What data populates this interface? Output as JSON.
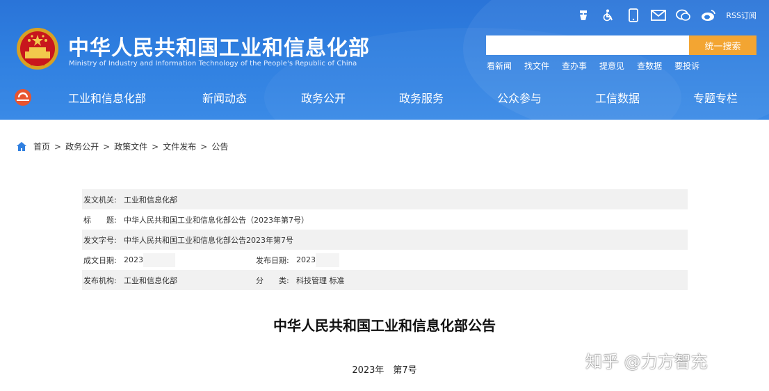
{
  "site": {
    "title_cn": "中华人民共和国工业和信息化部",
    "title_en": "Ministry of Industry and Information Technology of the People's Republic of China"
  },
  "top_icons": [
    "accessibility-tool-icon",
    "wheelchair-icon",
    "mobile-icon",
    "mail-icon",
    "weibo-icon",
    "wechat-icon"
  ],
  "rss_label": "RSS订阅",
  "search": {
    "placeholder": "",
    "button_label": "统一搜索"
  },
  "quick_links": [
    "看新闻",
    "找文件",
    "查办事",
    "提意见",
    "查数据",
    "要投诉"
  ],
  "nav": [
    "工业和信息化部",
    "新闻动态",
    "政务公开",
    "政务服务",
    "公众参与",
    "工信数据",
    "专题专栏"
  ],
  "breadcrumb": [
    "首页",
    "政务公开",
    "政策文件",
    "文件发布",
    "公告"
  ],
  "info": {
    "issuer_label": "发文机关:",
    "issuer": "工业和信息化部",
    "title_label": "标　　题:",
    "title": "中华人民共和国工业和信息化部公告（2023年第7号）",
    "docno_label": "发文字号:",
    "docno": "中华人民共和国工业和信息化部公告2023年第7号",
    "date_label": "成文日期:",
    "date": "2023",
    "pubdate_label": "发布日期:",
    "pubdate": "2023",
    "org_label": "发布机构:",
    "org": "工业和信息化部",
    "category_label": "分　　类:",
    "category": "科技管理 标准"
  },
  "document": {
    "title": "中华人民共和国工业和信息化部公告",
    "number": "2023年　第7号"
  },
  "watermark": "知乎 @力方智充",
  "colors": {
    "header_blue": "#2f7fe0",
    "search_button": "#f3a532",
    "row_shade": "#f1f1f1"
  }
}
